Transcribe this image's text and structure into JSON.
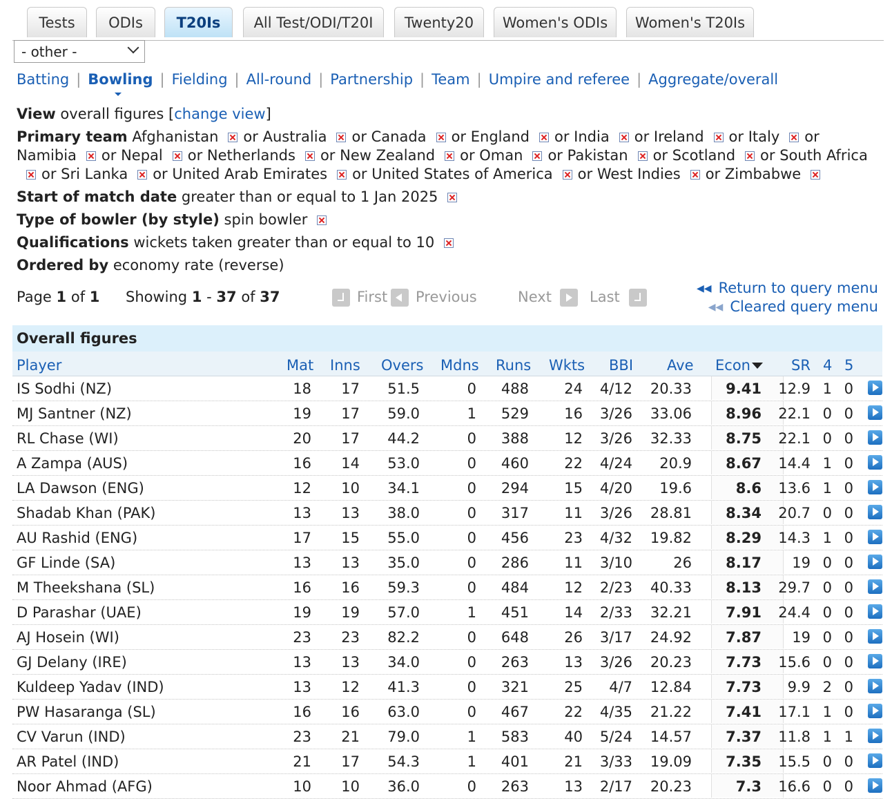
{
  "tabs": [
    "Tests",
    "ODIs",
    "T20Is",
    "All Test/ODI/T20I",
    "Twenty20",
    "Women's ODIs",
    "Women's T20Is"
  ],
  "active_tab": "T20Is",
  "select": {
    "value": "- other -"
  },
  "subnav": [
    "Batting",
    "Bowling",
    "Fielding",
    "All-round",
    "Partnership",
    "Team",
    "Umpire and referee",
    "Aggregate/overall"
  ],
  "active_subnav": "Bowling",
  "criteria": {
    "view_label": "View",
    "view_text": "overall figures",
    "change_view": "change view",
    "primary_label": "Primary team",
    "teams": [
      "Afghanistan",
      "Australia",
      "Canada",
      "England",
      "India",
      "Ireland",
      "Italy",
      "Namibia",
      "Nepal",
      "Netherlands",
      "New Zealand",
      "Oman",
      "Pakistan",
      "Scotland",
      "South Africa",
      "Sri Lanka",
      "United Arab Emirates",
      "United States of America",
      "West Indies",
      "Zimbabwe"
    ],
    "or_word": "or",
    "date_label": "Start of match date",
    "date_text": "greater than or equal to 1 Jan 2025",
    "bowler_label": "Type of bowler (by style)",
    "bowler_text": "spin bowler",
    "qual_label": "Qualifications",
    "qual_text": "wickets taken greater than or equal to 10",
    "order_label": "Ordered by",
    "order_text": "economy rate (reverse)"
  },
  "pagination": {
    "page_word": "Page",
    "page": "1",
    "of_word": "of",
    "pages": "1",
    "showing_word": "Showing",
    "from": "1",
    "dash": "-",
    "to": "37",
    "total": "37",
    "first": "First",
    "previous": "Previous",
    "next": "Next",
    "last": "Last",
    "return_link": "Return to query menu",
    "cleared_link": "Cleared query menu"
  },
  "table": {
    "caption": "Overall figures",
    "headers": [
      "Player",
      "Mat",
      "Inns",
      "Overs",
      "Mdns",
      "Runs",
      "Wkts",
      "BBI",
      "Ave",
      "Econ",
      "SR",
      "4",
      "5"
    ],
    "rows": [
      [
        "IS Sodhi (NZ)",
        "18",
        "17",
        "51.5",
        "0",
        "488",
        "24",
        "4/12",
        "20.33",
        "9.41",
        "12.9",
        "1",
        "0"
      ],
      [
        "MJ Santner (NZ)",
        "19",
        "17",
        "59.0",
        "1",
        "529",
        "16",
        "3/26",
        "33.06",
        "8.96",
        "22.1",
        "0",
        "0"
      ],
      [
        "RL Chase (WI)",
        "20",
        "17",
        "44.2",
        "0",
        "388",
        "12",
        "3/26",
        "32.33",
        "8.75",
        "22.1",
        "0",
        "0"
      ],
      [
        "A Zampa (AUS)",
        "16",
        "14",
        "53.0",
        "0",
        "460",
        "22",
        "4/24",
        "20.9",
        "8.67",
        "14.4",
        "1",
        "0"
      ],
      [
        "LA Dawson (ENG)",
        "12",
        "10",
        "34.1",
        "0",
        "294",
        "15",
        "4/20",
        "19.6",
        "8.6",
        "13.6",
        "1",
        "0"
      ],
      [
        "Shadab Khan (PAK)",
        "13",
        "13",
        "38.0",
        "0",
        "317",
        "11",
        "3/26",
        "28.81",
        "8.34",
        "20.7",
        "0",
        "0"
      ],
      [
        "AU Rashid (ENG)",
        "17",
        "15",
        "55.0",
        "0",
        "456",
        "23",
        "4/32",
        "19.82",
        "8.29",
        "14.3",
        "1",
        "0"
      ],
      [
        "GF Linde (SA)",
        "13",
        "13",
        "35.0",
        "0",
        "286",
        "11",
        "3/10",
        "26",
        "8.17",
        "19",
        "0",
        "0"
      ],
      [
        "M Theekshana (SL)",
        "16",
        "16",
        "59.3",
        "0",
        "484",
        "12",
        "2/23",
        "40.33",
        "8.13",
        "29.7",
        "0",
        "0"
      ],
      [
        "D Parashar (UAE)",
        "19",
        "19",
        "57.0",
        "1",
        "451",
        "14",
        "2/33",
        "32.21",
        "7.91",
        "24.4",
        "0",
        "0"
      ],
      [
        "AJ Hosein (WI)",
        "23",
        "23",
        "82.2",
        "0",
        "648",
        "26",
        "3/17",
        "24.92",
        "7.87",
        "19",
        "0",
        "0"
      ],
      [
        "GJ Delany (IRE)",
        "13",
        "13",
        "34.0",
        "0",
        "263",
        "13",
        "3/26",
        "20.23",
        "7.73",
        "15.6",
        "0",
        "0"
      ],
      [
        "Kuldeep Yadav (IND)",
        "13",
        "12",
        "41.3",
        "0",
        "321",
        "25",
        "4/7",
        "12.84",
        "7.73",
        "9.9",
        "2",
        "0"
      ],
      [
        "PW Hasaranga (SL)",
        "16",
        "16",
        "63.0",
        "0",
        "467",
        "22",
        "4/35",
        "21.22",
        "7.41",
        "17.1",
        "1",
        "0"
      ],
      [
        "CV Varun (IND)",
        "23",
        "21",
        "79.0",
        "1",
        "583",
        "40",
        "5/24",
        "14.57",
        "7.37",
        "11.8",
        "1",
        "1"
      ],
      [
        "AR Patel (IND)",
        "21",
        "17",
        "54.3",
        "1",
        "401",
        "21",
        "3/33",
        "19.09",
        "7.35",
        "15.5",
        "0",
        "0"
      ],
      [
        "Noor Ahmad (AFG)",
        "10",
        "10",
        "36.0",
        "0",
        "263",
        "13",
        "2/17",
        "20.23",
        "7.3",
        "16.6",
        "0",
        "0"
      ]
    ]
  },
  "icons": {
    "remove": "remove-filter-icon",
    "row_action": "play-arrow-icon",
    "sort": "sort-desc-icon"
  },
  "colors": {
    "link": "#1a5fb4",
    "active_tab": "#bfe2f6",
    "caption_bg": "#dcf0fb",
    "remove": "#dd2222"
  }
}
